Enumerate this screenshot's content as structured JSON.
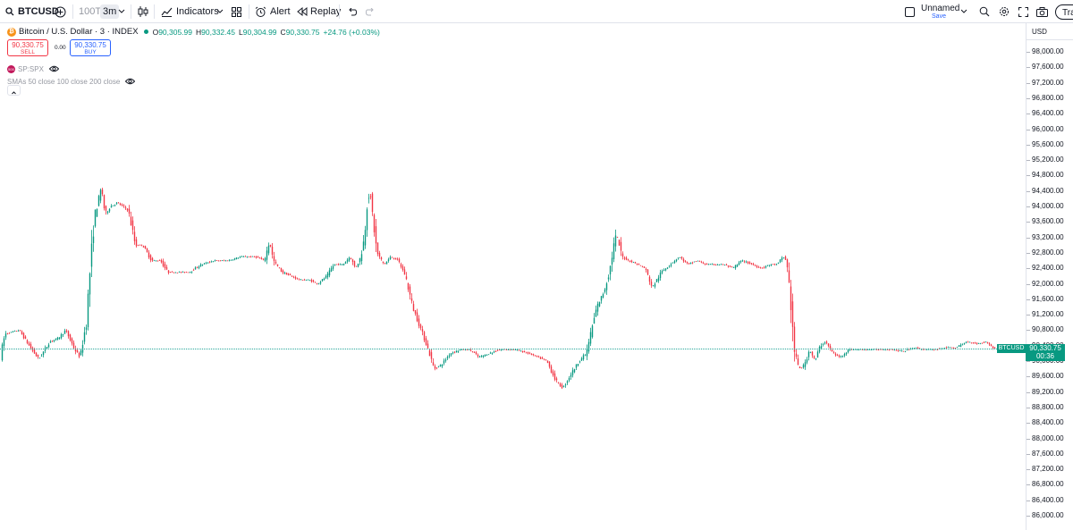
{
  "toolbar": {
    "symbol": "BTCUSD",
    "interval_100t": "100T",
    "interval_3m": "3m",
    "indicators_label": "Indicators",
    "alert_label": "Alert",
    "replay_label": "Replay",
    "layout_name": "Unnamed",
    "layout_save": "Save",
    "trade_label": "Trade"
  },
  "legend": {
    "logo": "₿",
    "title": "Bitcoin / U.S. Dollar · 3 · INDEX",
    "open_key": "O",
    "open": "90,305.99",
    "high_key": "H",
    "high": "90,332.45",
    "low_key": "L",
    "low": "90,304.99",
    "close_key": "C",
    "close": "90,330.75",
    "change": "+24.76 (+0.03%)",
    "sell_price": "90,330.75",
    "sell_label": "SELL",
    "spread": "0.00",
    "buy_price": "90,330.75",
    "buy_label": "BUY",
    "spx_logo": "500",
    "spx_label": "SP:SPX",
    "sma_label": "SMAs 50 close 100 close 200 close"
  },
  "price_axis": {
    "currency": "USD",
    "ticks": [
      "98,000.00",
      "97,600.00",
      "97,200.00",
      "96,800.00",
      "96,400.00",
      "96,000.00",
      "95,600.00",
      "95,200.00",
      "94,800.00",
      "94,400.00",
      "94,000.00",
      "93,600.00",
      "93,200.00",
      "92,800.00",
      "92,400.00",
      "92,000.00",
      "91,600.00",
      "91,200.00",
      "90,800.00",
      "90,400.00",
      "90,000.00",
      "89,600.00",
      "89,200.00",
      "88,800.00",
      "88,400.00",
      "88,000.00",
      "87,600.00",
      "87,200.00",
      "86,800.00",
      "86,400.00",
      "86,000.00"
    ]
  },
  "current_price": {
    "symbol_tag": "BTCUSD",
    "price": "90,330.75",
    "countdown": "00:36",
    "value": 90330.75
  },
  "chart_data": {
    "type": "candlestick",
    "symbol": "BTCUSD",
    "interval": "3m",
    "ylim": [
      85800,
      98300
    ],
    "anchors": [
      [
        0,
        90000
      ],
      [
        6,
        90700
      ],
      [
        22,
        90800
      ],
      [
        36,
        90300
      ],
      [
        44,
        90050
      ],
      [
        56,
        90500
      ],
      [
        66,
        90600
      ],
      [
        74,
        90800
      ],
      [
        84,
        90300
      ],
      [
        90,
        90100
      ],
      [
        97,
        91000
      ],
      [
        101,
        92300
      ],
      [
        106,
        93700
      ],
      [
        111,
        94200
      ],
      [
        114,
        94500
      ],
      [
        118,
        93800
      ],
      [
        124,
        94000
      ],
      [
        132,
        94100
      ],
      [
        144,
        93900
      ],
      [
        152,
        93000
      ],
      [
        160,
        93000
      ],
      [
        170,
        92600
      ],
      [
        180,
        92600
      ],
      [
        188,
        92300
      ],
      [
        200,
        92300
      ],
      [
        212,
        92300
      ],
      [
        226,
        92500
      ],
      [
        240,
        92600
      ],
      [
        256,
        92600
      ],
      [
        270,
        92700
      ],
      [
        286,
        92700
      ],
      [
        296,
        92600
      ],
      [
        302,
        93100
      ],
      [
        306,
        92600
      ],
      [
        316,
        92300
      ],
      [
        326,
        92200
      ],
      [
        336,
        92100
      ],
      [
        346,
        92100
      ],
      [
        356,
        92000
      ],
      [
        366,
        92200
      ],
      [
        374,
        92500
      ],
      [
        384,
        92500
      ],
      [
        392,
        92700
      ],
      [
        398,
        92400
      ],
      [
        404,
        92700
      ],
      [
        408,
        93200
      ],
      [
        411,
        94100
      ],
      [
        414,
        94400
      ],
      [
        418,
        93600
      ],
      [
        422,
        92800
      ],
      [
        430,
        92500
      ],
      [
        438,
        92700
      ],
      [
        446,
        92600
      ],
      [
        454,
        92200
      ],
      [
        462,
        91400
      ],
      [
        470,
        90900
      ],
      [
        478,
        90400
      ],
      [
        486,
        89800
      ],
      [
        494,
        89900
      ],
      [
        504,
        90200
      ],
      [
        516,
        90300
      ],
      [
        526,
        90300
      ],
      [
        536,
        90100
      ],
      [
        548,
        90200
      ],
      [
        560,
        90300
      ],
      [
        576,
        90300
      ],
      [
        592,
        90200
      ],
      [
        602,
        90100
      ],
      [
        612,
        90000
      ],
      [
        622,
        89500
      ],
      [
        630,
        89300
      ],
      [
        640,
        89700
      ],
      [
        648,
        90000
      ],
      [
        656,
        90200
      ],
      [
        662,
        90800
      ],
      [
        668,
        91400
      ],
      [
        676,
        91800
      ],
      [
        682,
        92300
      ],
      [
        687,
        93000
      ],
      [
        690,
        93300
      ],
      [
        696,
        92700
      ],
      [
        704,
        92600
      ],
      [
        714,
        92500
      ],
      [
        722,
        92400
      ],
      [
        730,
        91900
      ],
      [
        740,
        92300
      ],
      [
        750,
        92500
      ],
      [
        760,
        92700
      ],
      [
        770,
        92500
      ],
      [
        780,
        92600
      ],
      [
        790,
        92500
      ],
      [
        800,
        92500
      ],
      [
        810,
        92500
      ],
      [
        820,
        92400
      ],
      [
        830,
        92600
      ],
      [
        842,
        92500
      ],
      [
        852,
        92400
      ],
      [
        862,
        92500
      ],
      [
        870,
        92500
      ],
      [
        876,
        92700
      ],
      [
        880,
        92600
      ],
      [
        884,
        91800
      ],
      [
        888,
        90400
      ],
      [
        892,
        89900
      ],
      [
        896,
        89800
      ],
      [
        900,
        89900
      ],
      [
        906,
        90300
      ],
      [
        912,
        90000
      ],
      [
        918,
        90400
      ],
      [
        924,
        90500
      ],
      [
        932,
        90200
      ],
      [
        940,
        90100
      ],
      [
        950,
        90300
      ],
      [
        962,
        90300
      ],
      [
        974,
        90300
      ],
      [
        986,
        90300
      ],
      [
        998,
        90300
      ],
      [
        1010,
        90250
      ],
      [
        1022,
        90350
      ],
      [
        1034,
        90300
      ],
      [
        1046,
        90300
      ],
      [
        1058,
        90350
      ],
      [
        1070,
        90350
      ],
      [
        1082,
        90500
      ],
      [
        1094,
        90450
      ],
      [
        1104,
        90500
      ],
      [
        1110,
        90350
      ],
      [
        1113,
        90330
      ]
    ]
  }
}
